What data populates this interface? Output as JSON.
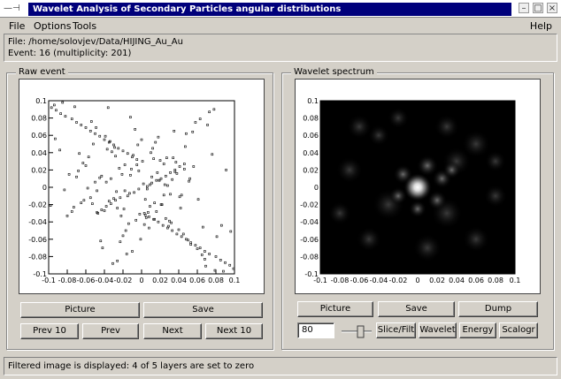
{
  "window": {
    "title": "Wavelet Analysis of Secondary Particles angular distributions",
    "minimize": "–",
    "maximize": "□",
    "close": "×"
  },
  "menu": {
    "file": "File",
    "options": "Options",
    "tools": "Tools",
    "help": "Help"
  },
  "info": {
    "file_line": "File: /home/solovjev/Data/HIJING_Au_Au",
    "event_line": "Event: 16   (multiplicity: 201)"
  },
  "raw_panel": {
    "legend": "Raw event",
    "picture_btn": "Picture",
    "save_btn": "Save",
    "prev10_btn": "Prev 10",
    "prev_btn": "Prev",
    "next_btn": "Next",
    "next10_btn": "Next 10"
  },
  "wavelet_panel": {
    "legend": "Wavelet spectrum",
    "picture_btn": "Picture",
    "save_btn": "Save",
    "dump_btn": "Dump",
    "value_field": "80",
    "slice_btn": "Slice/Filt",
    "wavelet_btn": "Wavelet",
    "energy_btn": "Energy",
    "scalogr_btn": "Scalogr"
  },
  "status": {
    "text": "Filtered image is displayed: 4 of 5 layers are set to zero"
  },
  "chart_data": [
    {
      "type": "scatter",
      "xlim": [
        -0.1,
        0.1
      ],
      "ylim": [
        -0.1,
        0.1
      ],
      "x_ticks": [
        "-0.1",
        "-0.08",
        "-0.06",
        "-0.04",
        "-0.02",
        "0",
        "0.02",
        "0.04",
        "0.06",
        "0.08",
        "0.1"
      ],
      "y_ticks": [
        "-0.1",
        "-0.08",
        "-0.06",
        "-0.04",
        "-0.02",
        "0",
        "0.02",
        "0.04",
        "0.06",
        "0.08",
        "0.1"
      ],
      "x": [
        0.002,
        -0.008,
        0.011,
        -0.015,
        0.006,
        0.019,
        -0.021,
        0.004,
        -0.003,
        0.014,
        -0.011,
        0.025,
        -0.027,
        0.009,
        -0.005,
        0.017,
        -0.019,
        0.031,
        -0.033,
        0.001,
        0.007,
        -0.012,
        0.022,
        -0.024,
        0.013,
        -0.002,
        0.028,
        -0.03,
        0.036,
        -0.038,
        0.005,
        -0.009,
        0.016,
        -0.018,
        0.041,
        -0.043,
        0.01,
        -0.006,
        0.024,
        -0.026,
        0.003,
        0.033,
        -0.035,
        0.046,
        -0.048,
        0.012,
        -0.014,
        0.02,
        -0.022,
        0.051,
        -0.053,
        0.008,
        -0.004,
        0.038,
        -0.04,
        0.015,
        -0.017,
        0.026,
        -0.028,
        0.056,
        -0.058,
        0.0,
        0.043,
        -0.045,
        0.018,
        -0.02,
        0.03,
        -0.032,
        0.061,
        -0.063,
        -0.001,
        0.048,
        -0.05,
        0.021,
        -0.023,
        0.035,
        -0.037,
        0.066,
        -0.068,
        0.004,
        -0.007,
        0.053,
        -0.055,
        0.027,
        -0.029,
        0.04,
        -0.042,
        0.071,
        -0.073,
        0.009,
        -0.01,
        0.058,
        -0.06,
        0.032,
        -0.034,
        0.045,
        -0.047,
        0.076,
        -0.078,
        0.014,
        -0.016,
        0.063,
        -0.065,
        0.037,
        -0.039,
        0.05,
        -0.052,
        0.081,
        -0.083,
        0.019,
        -0.012,
        0.068,
        -0.07,
        0.042,
        -0.044,
        0.055,
        -0.057,
        0.086,
        -0.088,
        0.024,
        -0.026,
        0.073,
        -0.075,
        0.047,
        -0.049,
        0.06,
        -0.062,
        0.091,
        -0.093,
        0.029,
        -0.031,
        0.078,
        -0.08,
        0.052,
        -0.054,
        0.065,
        -0.067,
        0.096,
        -0.098,
        0.034,
        -0.036,
        0.006,
        -0.003,
        0.011,
        -0.013,
        0.016,
        -0.018,
        0.021,
        -0.023,
        0.026,
        -0.028,
        0.031,
        -0.033,
        0.036,
        -0.038,
        0.041,
        -0.043,
        0.046,
        -0.048,
        0.003,
        -0.005,
        0.008,
        -0.01,
        0.013,
        -0.015,
        0.018,
        -0.02,
        0.023,
        -0.025,
        0.028,
        -0.03,
        0.033,
        -0.035,
        0.038,
        -0.04,
        0.043,
        -0.045,
        0.048,
        -0.05,
        0.053,
        -0.055,
        0.058,
        -0.06,
        0.063,
        -0.065,
        0.068,
        -0.07,
        0.073,
        -0.075,
        0.08,
        -0.082,
        0.085,
        -0.087,
        0.09,
        -0.092,
        0.095,
        -0.097,
        0.099,
        -0.094,
        0.088,
        -0.085,
        0.079,
        -0.072,
        0.069
      ],
      "y": [
        0.004,
        -0.006,
        0.012,
        -0.01,
        -0.002,
        0.008,
        0.015,
        -0.014,
        0.019,
        -0.018,
        0.021,
        0.003,
        -0.005,
        -0.022,
        0.026,
        0.017,
        -0.025,
        -0.008,
        0.01,
        0.03,
        -0.029,
        0.014,
        -0.02,
        0.022,
        0.033,
        -0.031,
        0.002,
        -0.013,
        0.018,
        0.006,
        -0.035,
        0.037,
        -0.028,
        0.026,
        -0.011,
        0.013,
        0.04,
        -0.038,
        0.027,
        -0.024,
        -0.043,
        0.009,
        -0.016,
        0.021,
        -0.004,
        0.045,
        -0.042,
        0.031,
        -0.033,
        0.007,
        -0.019,
        -0.047,
        0.049,
        0.016,
        -0.027,
        0.052,
        -0.05,
        -0.036,
        0.036,
        0.024,
        -0.001,
        0.055,
        -0.009,
        0.011,
        0.058,
        -0.056,
        -0.039,
        0.041,
        -0.014,
        0.028,
        -0.06,
        0.062,
        0.006,
        -0.02,
        -0.063,
        0.065,
        0.044,
        -0.046,
        0.019,
        -0.032,
        0.067,
        -0.066,
        -0.012,
        0.034,
        0.046,
        -0.049,
        -0.07,
        0.072,
        -0.023,
        0.003,
        -0.074,
        0.075,
        0.025,
        -0.041,
        0.053,
        -0.054,
        -0.03,
        0.038,
        0.015,
        -0.037,
        -0.077,
        0.079,
        -0.018,
        0.029,
        0.059,
        -0.061,
        0.05,
        -0.057,
        -0.003,
        0.008,
        0.081,
        -0.083,
        0.012,
        -0.024,
        -0.062,
        0.064,
        0.035,
        -0.044,
        0.043,
        -0.009,
        -0.085,
        0.087,
        -0.028,
        0.047,
        0.069,
        -0.071,
        -0.015,
        0.02,
        0.056,
        -0.045,
        -0.088,
        0.09,
        -0.033,
        0.01,
        0.076,
        -0.078,
        0.039,
        -0.051,
        -0.021,
        0.034,
        0.092,
        0.001,
        -0.002,
        0.005,
        -0.007,
        0.008,
        -0.004,
        0.01,
        -0.012,
        0.013,
        -0.015,
        0.017,
        -0.019,
        0.02,
        -0.022,
        0.024,
        -0.026,
        0.027,
        -0.029,
        -0.03,
        0.032,
        -0.034,
        0.035,
        -0.037,
        0.039,
        -0.04,
        0.042,
        -0.044,
        0.045,
        -0.047,
        0.049,
        -0.05,
        0.052,
        -0.054,
        0.055,
        -0.057,
        0.059,
        -0.06,
        0.062,
        -0.064,
        0.065,
        -0.067,
        0.069,
        -0.07,
        0.072,
        -0.074,
        0.075,
        -0.077,
        0.079,
        -0.08,
        0.082,
        -0.084,
        0.085,
        -0.087,
        0.089,
        -0.09,
        0.092,
        -0.094,
        0.095,
        -0.097,
        0.098,
        -0.096,
        0.093,
        -0.091,
        0.086,
        -0.083,
        0.078,
        -0.073,
        0.068
      ]
    },
    {
      "type": "heatmap",
      "xlim": [
        -0.1,
        0.1
      ],
      "ylim": [
        -0.1,
        0.1
      ],
      "x_ticks": [
        "-0.1",
        "-0.08",
        "-0.06",
        "-0.04",
        "-0.02",
        "0",
        "0.02",
        "0.04",
        "0.06",
        "0.08",
        "0.1"
      ],
      "y_ticks": [
        "-0.1",
        "-0.08",
        "-0.06",
        "-0.04",
        "-0.02",
        "0",
        "0.02",
        "0.04",
        "0.06",
        "0.08",
        "0.1"
      ],
      "peak": [
        0.0,
        0.0
      ]
    }
  ]
}
